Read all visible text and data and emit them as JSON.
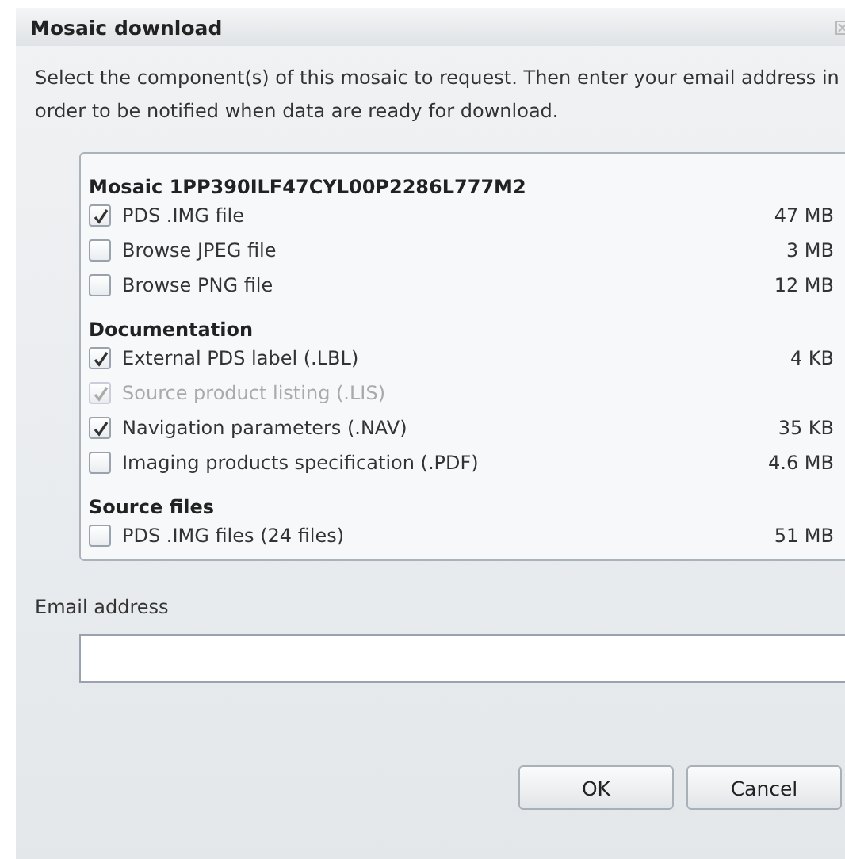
{
  "window": {
    "title": "Mosaic download"
  },
  "instructions": "Select the component(s) of this mosaic to request. Then enter your email address in order to be notified when data are ready for download.",
  "groups": [
    {
      "title": "Mosaic 1PP390ILF47CYL00P2286L777M2",
      "items": [
        {
          "label": "PDS .IMG file",
          "size": "47 MB",
          "checked": true,
          "disabled": false
        },
        {
          "label": "Browse JPEG file",
          "size": "3 MB",
          "checked": false,
          "disabled": false
        },
        {
          "label": "Browse PNG file",
          "size": "12 MB",
          "checked": false,
          "disabled": false
        }
      ]
    },
    {
      "title": "Documentation",
      "items": [
        {
          "label": "External PDS label (.LBL)",
          "size": "4 KB",
          "checked": true,
          "disabled": false
        },
        {
          "label": "Source product listing (.LIS)",
          "checked": true,
          "disabled": true
        },
        {
          "label": "Navigation parameters (.NAV)",
          "size": "35 KB",
          "checked": true,
          "disabled": false
        },
        {
          "label": "Imaging products specification (.PDF)",
          "size": "4.6 MB",
          "checked": false,
          "disabled": false
        }
      ]
    },
    {
      "title": "Source files",
      "items": [
        {
          "label": "PDS .IMG files (24 files)",
          "size": "51 MB",
          "checked": false,
          "disabled": false
        }
      ]
    }
  ],
  "email": {
    "label": "Email address"
  },
  "buttons": [
    "OK",
    "Cancel"
  ]
}
